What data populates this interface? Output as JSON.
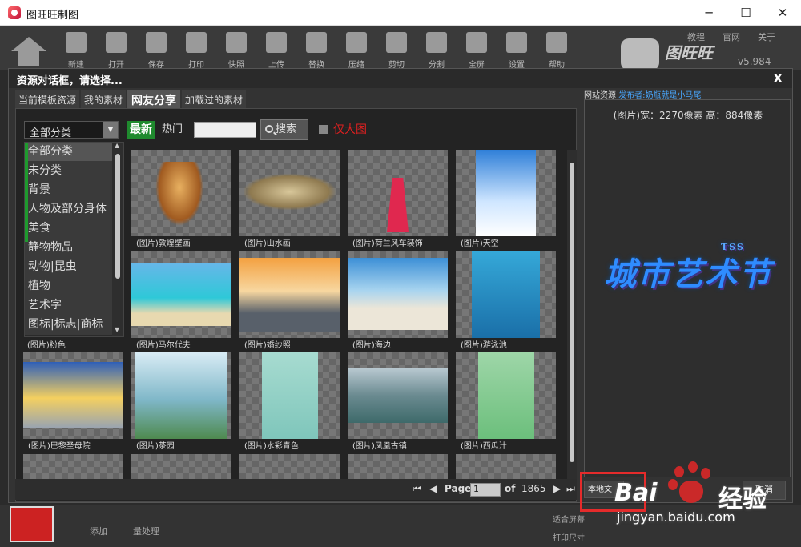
{
  "window": {
    "title": "图旺旺制图",
    "minimize": "─",
    "maximize": "☐",
    "close": "✕"
  },
  "toolbar": {
    "items": [
      "新建",
      "打开",
      "保存",
      "打印",
      "快照",
      "上传",
      "替换",
      "压缩",
      "剪切",
      "分割",
      "全屏",
      "设置",
      "帮助"
    ],
    "links": [
      "教程",
      "官网",
      "关于"
    ],
    "brand": "图旺旺",
    "brand_sub": "TUWANGWANG",
    "version": "v5.984"
  },
  "bottom": {
    "add": "添加",
    "batch": "量处理",
    "fit": "适合屏幕",
    "print_size": "打印尺寸"
  },
  "dialog": {
    "title": "资源对话框，请选择...",
    "close": "X",
    "tabs": [
      "当前模板资源",
      "我的素材",
      "网友分享",
      "加载过的素材"
    ],
    "active_tab": 2,
    "category_select": "全部分类",
    "select_arrow": "▼",
    "filters": {
      "latest": "最新",
      "hot": "热门",
      "search": "搜索",
      "big_only": "仅大图"
    },
    "categories": [
      "全部分类",
      "未分类",
      "背景",
      "人物及部分身体",
      "美食",
      "静物物品",
      "动物|昆虫",
      "植物",
      "艺术字",
      "图标|标志|商标"
    ],
    "scroll_up": "▲",
    "scroll_down": "▼",
    "grid": [
      {
        "caption": "(图片)敦煌壁画"
      },
      {
        "caption": "(图片)山水画"
      },
      {
        "caption": "(图片)荷兰风车装饰"
      },
      {
        "caption": "(图片)天空"
      },
      {
        "caption": "(图片)粉色"
      },
      {
        "caption": "(图片)马尔代夫"
      },
      {
        "caption": "(图片)婚纱照"
      },
      {
        "caption": "(图片)海边"
      },
      {
        "caption": "(图片)游泳池"
      },
      {
        "caption": "(图片)巴黎圣母院"
      },
      {
        "caption": "(图片)茶园"
      },
      {
        "caption": "(图片)水彩青色"
      },
      {
        "caption": "(图片)凤凰古镇"
      },
      {
        "caption": "(图片)西瓜汁"
      }
    ],
    "pager": {
      "first": "⏮",
      "prev": "◀",
      "label": "Page",
      "value": "1",
      "of": "of",
      "total": "1865",
      "next": "▶",
      "last": "⏭"
    },
    "resource_label": "网站资源",
    "publisher_label": "发布者:",
    "publisher": "奶瓶就是小马尾",
    "preview": {
      "dims": "(图片)宽：2270像素 高：884像素",
      "art_text": "城市艺术节",
      "art_tag": "TSS"
    },
    "local_btn": "本地文",
    "cancel": "取消"
  },
  "watermark": {
    "a": "Bai",
    "b": "经验",
    "url": "jingyan.baidu.com"
  },
  "colors": {
    "accent": "#1f8a2e",
    "highlight": "#e52b2b",
    "link": "#4aa8ff"
  }
}
